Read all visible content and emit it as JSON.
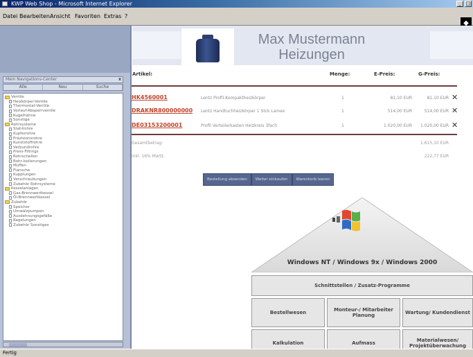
{
  "window": {
    "title": "KWP Web Shop - Microsoft Internet Explorer",
    "menus": [
      "Datei",
      "Bearbeiten",
      "Ansicht",
      "Favoriten",
      "Extras",
      "?"
    ],
    "min": "_",
    "restore": "□"
  },
  "nav": {
    "header": "Mein Navigations-Center",
    "close": "x",
    "tabs": [
      "Alle",
      "Neu",
      "Suche"
    ],
    "tree": [
      {
        "label": "Ventile",
        "folder": true,
        "level": 0
      },
      {
        "label": "Heizkörper-Ventile",
        "folder": false,
        "level": 1
      },
      {
        "label": "Thermostat-Ventile",
        "folder": false,
        "level": 1
      },
      {
        "label": "Vorlauf-Absperrventile",
        "folder": false,
        "level": 1
      },
      {
        "label": "Kugelhähne",
        "folder": false,
        "level": 1
      },
      {
        "label": "Sonstige",
        "folder": false,
        "level": 1
      },
      {
        "label": "Rohrsysteme",
        "folder": true,
        "level": 0
      },
      {
        "label": "Stahlrohre",
        "folder": false,
        "level": 1
      },
      {
        "label": "Kupferrohre",
        "folder": false,
        "level": 1
      },
      {
        "label": "Präzisionsrohre",
        "folder": false,
        "level": 1
      },
      {
        "label": "Kunststoffrohre",
        "folder": false,
        "level": 1
      },
      {
        "label": "Verbundrohre",
        "folder": false,
        "level": 1
      },
      {
        "label": "Press-Fittings",
        "folder": false,
        "level": 1
      },
      {
        "label": "Rohrschellen",
        "folder": false,
        "level": 1
      },
      {
        "label": "Rohr-Isolierungen",
        "folder": false,
        "level": 1
      },
      {
        "label": "Muffen",
        "folder": false,
        "level": 1
      },
      {
        "label": "Flansche",
        "folder": false,
        "level": 1
      },
      {
        "label": "Kupplungen",
        "folder": false,
        "level": 1
      },
      {
        "label": "Verschraubungen",
        "folder": false,
        "level": 1
      },
      {
        "label": "Zubehör Rohrsysteme",
        "folder": false,
        "level": 1
      },
      {
        "label": "Kesselanlagen",
        "folder": true,
        "level": 0
      },
      {
        "label": "Gas-Brennwertkessel",
        "folder": false,
        "level": 1
      },
      {
        "label": "Öl-Brennwertkessel",
        "folder": false,
        "level": 1
      },
      {
        "label": "Zubehör",
        "folder": true,
        "level": 0
      },
      {
        "label": "Speicher",
        "folder": false,
        "level": 1
      },
      {
        "label": "Umwälzpumpen",
        "folder": false,
        "level": 1
      },
      {
        "label": "Ausdehnungsgefäße",
        "folder": false,
        "level": 1
      },
      {
        "label": "Regelungen",
        "folder": false,
        "level": 1
      },
      {
        "label": "Zubehör Sonstiges",
        "folder": false,
        "level": 1
      }
    ]
  },
  "status": {
    "text": "Fertig"
  },
  "banner": {
    "company_line1": "Max Mustermann",
    "company_line2": "Heizungen"
  },
  "cart": {
    "headers": {
      "article": "Artikel:",
      "qty": "Menge:",
      "unit_price": "E-Preis:",
      "total_price": "G-Preis:"
    },
    "rows": [
      {
        "code": "HK4560001",
        "desc": "Lentz Profil-Kompaktheizkörper",
        "qty": "1",
        "unit_price": "81,10 EUR",
        "total_price": "81,10 EUR"
      },
      {
        "code": "DRAKNR800000000",
        "desc": "Lentz Handtuchheizkörper 1 Stck Lamex",
        "qty": "1",
        "unit_price": "514,00 EUR",
        "total_price": "514,00 EUR"
      },
      {
        "code": "DE03153200001",
        "desc": "Profil Verteilerkasten Heizkreis 3fach",
        "qty": "1",
        "unit_price": "1.020,00 EUR",
        "total_price": "1.020,00 EUR"
      }
    ],
    "delete_symbol": "✕",
    "net_label": "Gesamtbetrag:",
    "net_value": "1.615,10 EUR",
    "vat_label": "inkl. 16% MwSt.",
    "vat_value": "222,77 EUR"
  },
  "actions": [
    "Bestellung absenden",
    "Weiter einkaufen",
    "Warenkorb leeren"
  ],
  "pyramid": {
    "label": "Windows NT / Windows 9x / Windows 2000",
    "layer1": "Schnittstellen / Zusatz-Programme",
    "layer2": [
      "Bestellwesen",
      "Monteur-/ Mitarbeiter Planung",
      "Wartung/ Kundendienst"
    ],
    "layer3": [
      "Kalkulation",
      "Aufmass",
      "Materialwesen/ Projektüberwachung"
    ]
  },
  "colors": {
    "accent_red": "#c0432a",
    "button_blue": "#56678f",
    "nav_bg": "#b7c1d6"
  }
}
